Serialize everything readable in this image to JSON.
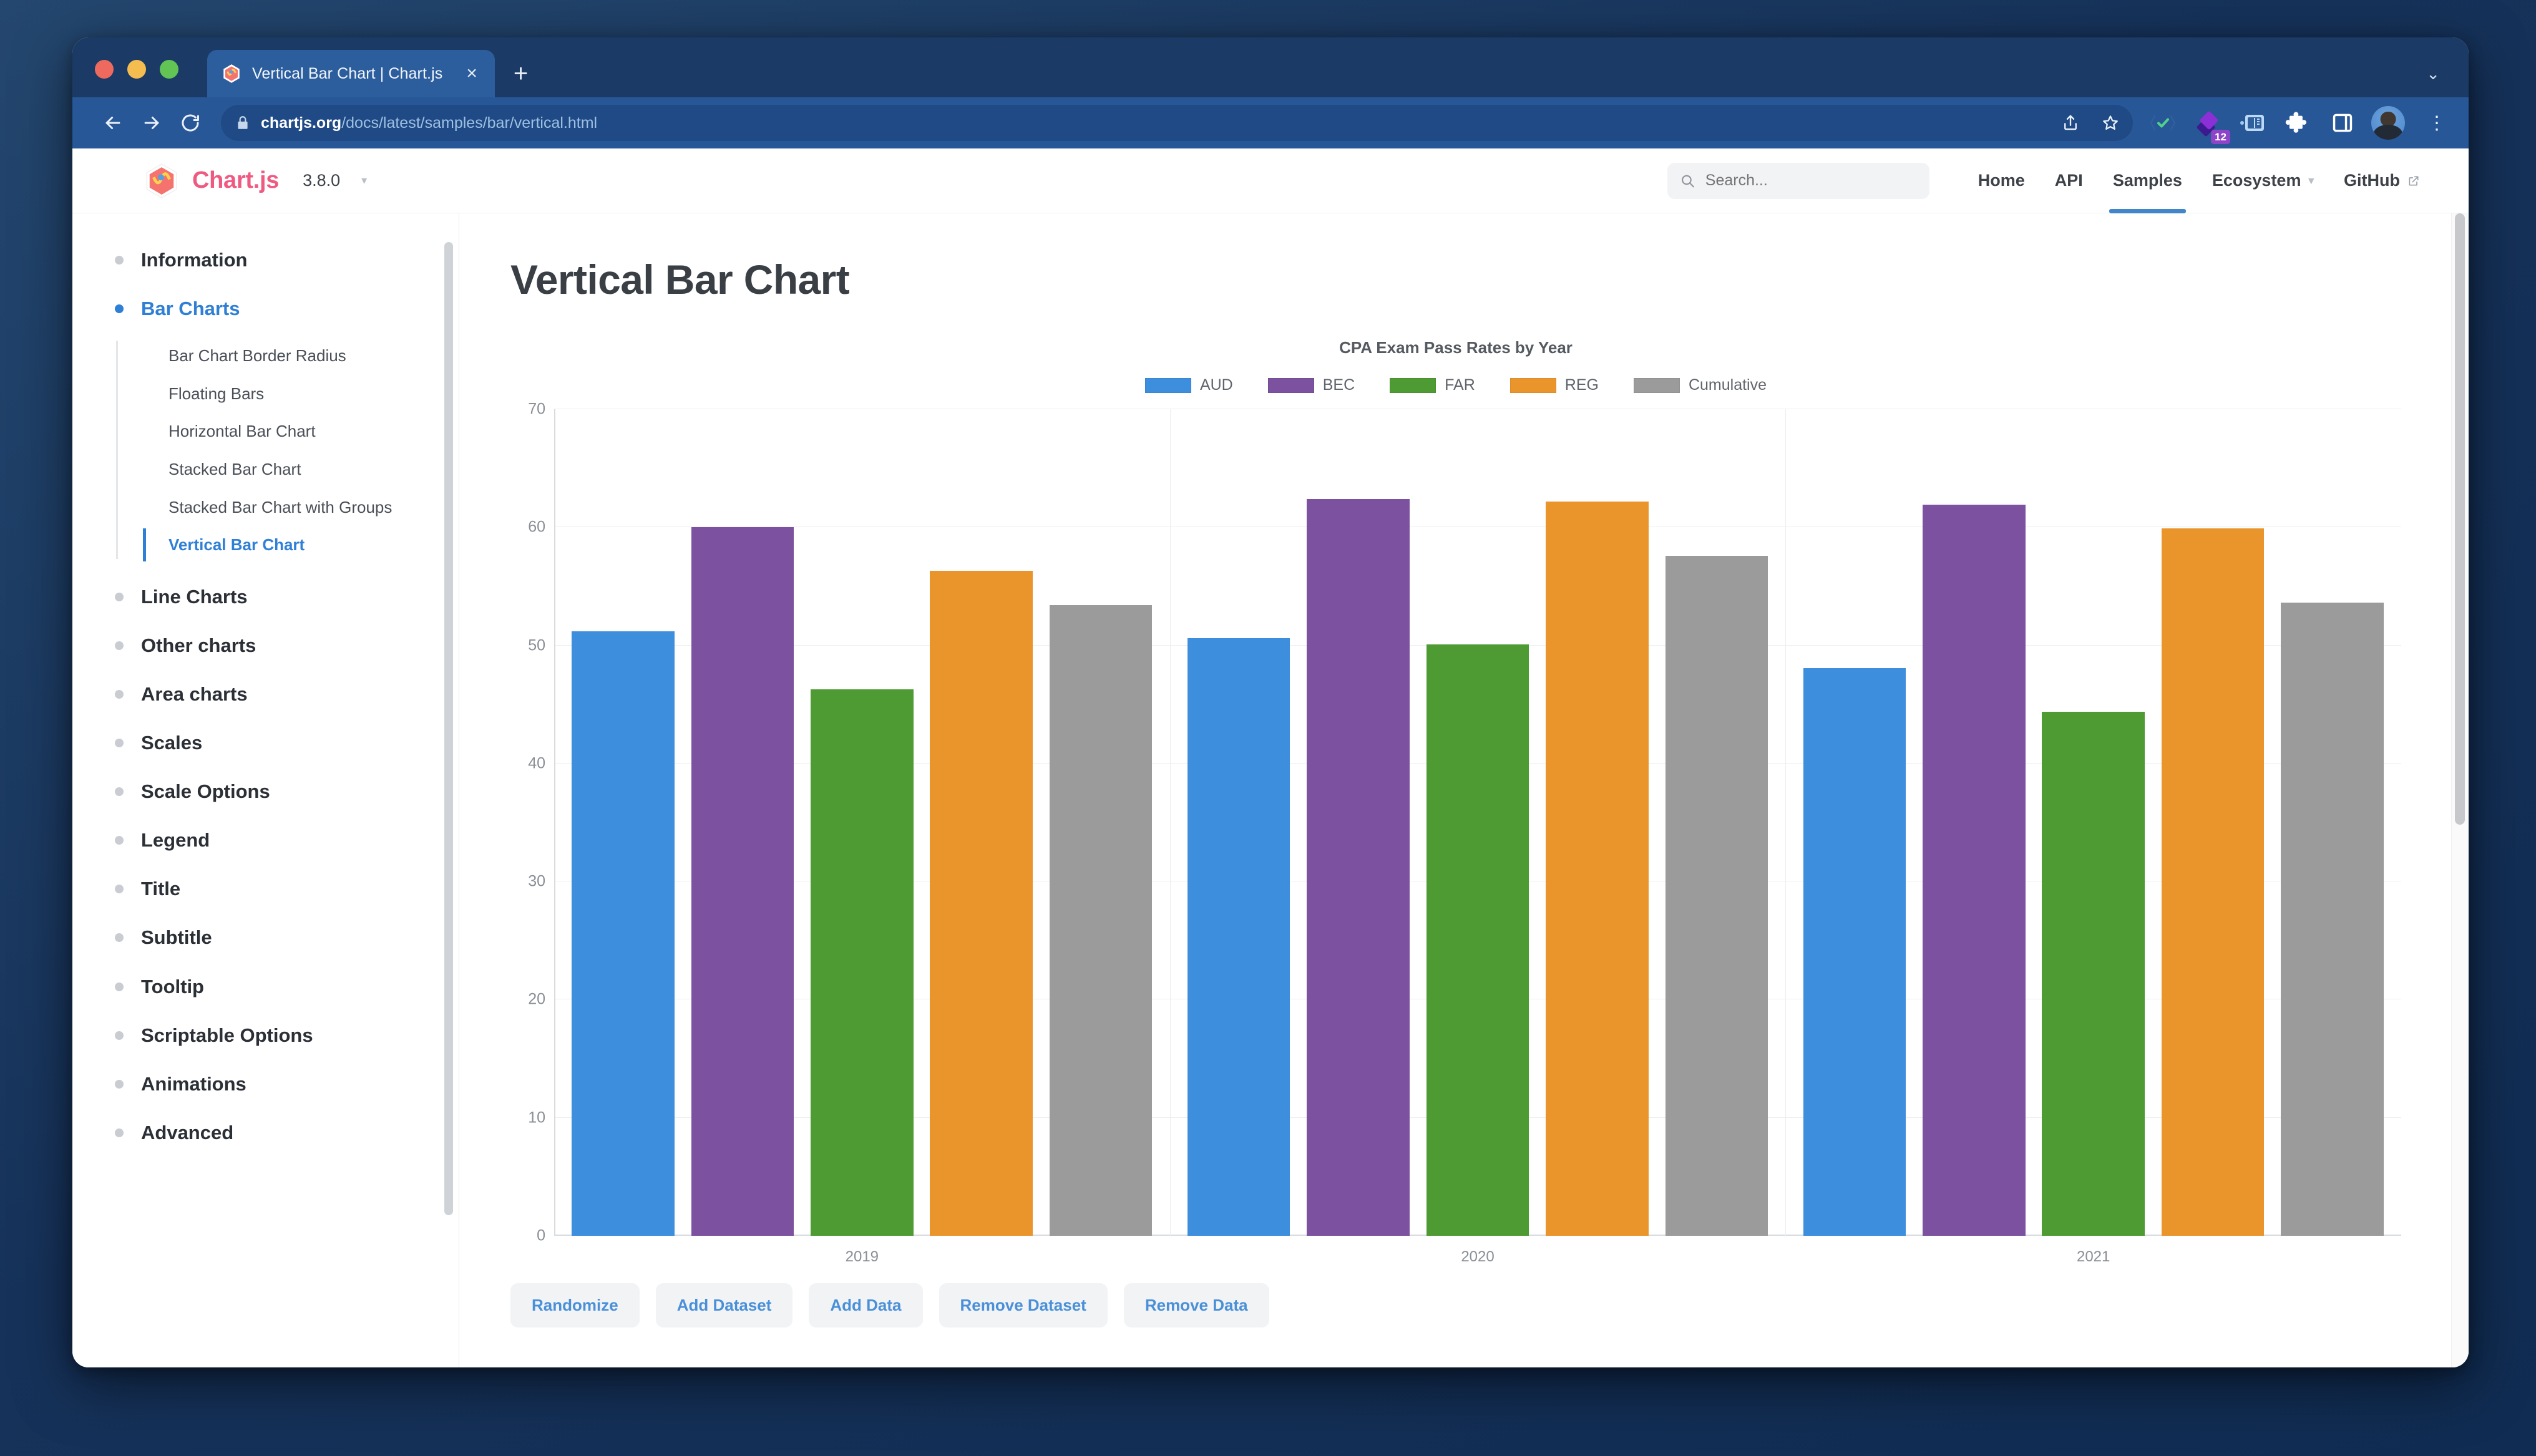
{
  "browser": {
    "tab": {
      "title": "Vertical Bar Chart | Chart.js",
      "favicon_name": "chartjs-favicon",
      "close_label": "×"
    },
    "new_tab_label": "+",
    "tab_list_caret": "⌄",
    "nav": {
      "back_label": "←",
      "forward_label": "→",
      "reload_label": "⟳"
    },
    "omnibox": {
      "host": "chartjs.org",
      "path": "/docs/latest/samples/bar/vertical.html",
      "lock_icon": "lock-icon",
      "share_icon": "share-icon",
      "bookmark_icon": "star-icon"
    },
    "extensions": [
      {
        "name": "checkmark-badge-icon",
        "label": ""
      },
      {
        "name": "purple-diamond-icon",
        "badge": "12"
      },
      {
        "name": "blue-panel-icon",
        "label": ""
      },
      {
        "name": "puzzle-piece-icon",
        "label": ""
      },
      {
        "name": "side-panel-icon",
        "label": ""
      }
    ],
    "profile_icon": "avatar",
    "menu_label": "⋮"
  },
  "site_header": {
    "brand": "Chart.js",
    "version": "3.8.0",
    "version_caret": "▾",
    "search": {
      "placeholder": "Search...",
      "value": "",
      "icon": "search-icon"
    },
    "nav_links": [
      {
        "label": "Home",
        "active": false,
        "external": false
      },
      {
        "label": "API",
        "active": false,
        "external": false
      },
      {
        "label": "Samples",
        "active": true,
        "external": false
      },
      {
        "label": "Ecosystem",
        "active": false,
        "external": false,
        "caret": "▾"
      },
      {
        "label": "GitHub",
        "active": false,
        "external": true
      }
    ]
  },
  "sidebar": {
    "items": [
      {
        "label": "Information",
        "active": false,
        "children": []
      },
      {
        "label": "Bar Charts",
        "active": true,
        "children": [
          {
            "label": "Bar Chart Border Radius",
            "active": false
          },
          {
            "label": "Floating Bars",
            "active": false
          },
          {
            "label": "Horizontal Bar Chart",
            "active": false
          },
          {
            "label": "Stacked Bar Chart",
            "active": false
          },
          {
            "label": "Stacked Bar Chart with Groups",
            "active": false
          },
          {
            "label": "Vertical Bar Chart",
            "active": true
          }
        ]
      },
      {
        "label": "Line Charts",
        "active": false,
        "children": []
      },
      {
        "label": "Other charts",
        "active": false,
        "children": []
      },
      {
        "label": "Area charts",
        "active": false,
        "children": []
      },
      {
        "label": "Scales",
        "active": false,
        "children": []
      },
      {
        "label": "Scale Options",
        "active": false,
        "children": []
      },
      {
        "label": "Legend",
        "active": false,
        "children": []
      },
      {
        "label": "Title",
        "active": false,
        "children": []
      },
      {
        "label": "Subtitle",
        "active": false,
        "children": []
      },
      {
        "label": "Tooltip",
        "active": false,
        "children": []
      },
      {
        "label": "Scriptable Options",
        "active": false,
        "children": []
      },
      {
        "label": "Animations",
        "active": false,
        "children": []
      },
      {
        "label": "Advanced",
        "active": false,
        "children": []
      }
    ]
  },
  "main": {
    "page_title": "Vertical Bar Chart",
    "buttons": [
      "Randomize",
      "Add Dataset",
      "Add Data",
      "Remove Dataset",
      "Remove Data"
    ]
  },
  "chart_data": {
    "type": "bar",
    "title": "CPA Exam Pass Rates by Year",
    "xlabel": "",
    "ylabel": "",
    "categories": [
      "2019",
      "2020",
      "2021"
    ],
    "ylim": [
      0,
      70
    ],
    "yticks": [
      0,
      10,
      20,
      30,
      40,
      50,
      60,
      70
    ],
    "grid": true,
    "legend_position": "top",
    "series": [
      {
        "name": "AUD",
        "color": "#3e8ede",
        "values": [
          51.2,
          50.6,
          48.1
        ]
      },
      {
        "name": "BEC",
        "color": "#7c519f",
        "values": [
          60.0,
          62.4,
          61.9
        ]
      },
      {
        "name": "FAR",
        "color": "#4f9b33",
        "values": [
          46.3,
          50.1,
          44.4
        ]
      },
      {
        "name": "REG",
        "color": "#e9952c",
        "values": [
          56.3,
          62.2,
          59.9
        ]
      },
      {
        "name": "Cumulative",
        "color": "#9b9b9b",
        "values": [
          53.4,
          57.6,
          53.6
        ]
      }
    ]
  }
}
